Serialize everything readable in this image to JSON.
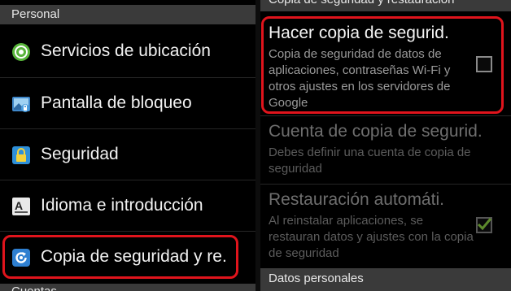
{
  "left": {
    "section_header": "Personal",
    "items": [
      {
        "label": "Servicios de ubicación",
        "icon": "location-icon"
      },
      {
        "label": "Pantalla de bloqueo",
        "icon": "lock-screen-icon"
      },
      {
        "label": "Seguridad",
        "icon": "security-lock-icon"
      },
      {
        "label": "Idioma e introducción",
        "icon": "language-icon"
      },
      {
        "label": "Copia de seguridad y re.",
        "icon": "backup-restore-icon"
      }
    ],
    "bottom_header": "Cuentas"
  },
  "right": {
    "section_header": "Copia de seguridad y restauración",
    "prefs": [
      {
        "title": "Hacer copia de segurid.",
        "summary": "Copia de seguridad de datos de aplicaciones, contraseñas Wi-Fi y otros ajustes en los servidores de Google",
        "checked": false,
        "enabled": true
      },
      {
        "title": "Cuenta de copia de segurid.",
        "summary": "Debes definir una cuenta de copia de seguridad",
        "enabled": false
      },
      {
        "title": "Restauración automáti.",
        "summary": "Al reinstalar aplicaciones, se restauran datos y ajustes con la copia de seguridad",
        "checked": true,
        "enabled": false
      }
    ],
    "bottom_header": "Datos personales"
  },
  "colors": {
    "highlight": "#e0141c",
    "header_bg": "#3a3a3a",
    "check_green": "#5d8a2c",
    "icon_blue": "#2e7fd0"
  }
}
